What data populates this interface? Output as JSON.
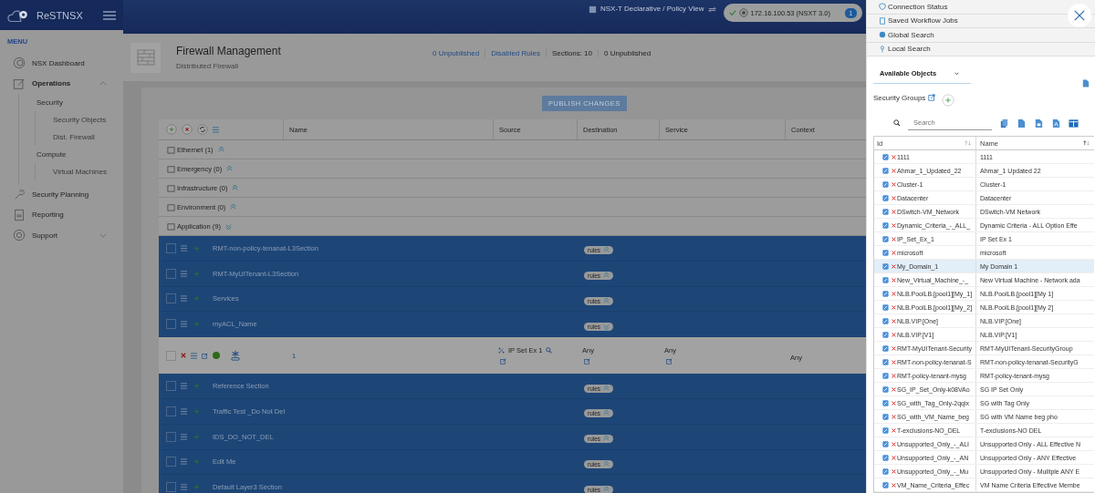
{
  "app": {
    "name": "ReSTNSX"
  },
  "topbar": {
    "view": "NSX-T Declarative / Policy View",
    "connection": "172.16.100.53 (NSXT 3.0)",
    "connected": true,
    "badge": "1"
  },
  "sidebar": {
    "heading": "MENU",
    "items": [
      {
        "label": "NSX Dashboard",
        "kind": "link"
      },
      {
        "label": "Operations",
        "kind": "group",
        "expanded": true,
        "children": [
          {
            "label": "Security",
            "children": [
              {
                "label": "Security Objects"
              },
              {
                "label": "Dist. Firewall"
              }
            ]
          },
          {
            "label": "Compute",
            "children": [
              {
                "label": "Virtual Machines"
              }
            ]
          }
        ]
      },
      {
        "label": "Security Planning",
        "kind": "link"
      },
      {
        "label": "Reporting",
        "kind": "link"
      },
      {
        "label": "Support",
        "kind": "group",
        "expanded": false
      }
    ]
  },
  "page": {
    "title": "Firewall Management",
    "subtitle": "Distributed Firewall",
    "stats": [
      {
        "text": "0 Unpublished",
        "kind": "link"
      },
      {
        "text": "Disabled Rules",
        "kind": "link"
      },
      {
        "text": "Sections: 10",
        "kind": "text"
      },
      {
        "text": "0 Unpublished",
        "kind": "text"
      }
    ],
    "publish": "PUBLISH CHANGES"
  },
  "table": {
    "columns": [
      "Name",
      "Source",
      "Destination",
      "Service",
      "Context"
    ],
    "categories": [
      {
        "label": "Ethernet (1)",
        "expanded": false
      },
      {
        "label": "Emergency (0)",
        "expanded": false
      },
      {
        "label": "Infrastructure (0)",
        "expanded": false
      },
      {
        "label": "Environment (0)",
        "expanded": false
      },
      {
        "label": "Application (9)",
        "expanded": true
      }
    ],
    "sections": [
      {
        "name": "RMT-non-policy-tenanat-L3Section",
        "rules_label": "rules",
        "checked": false,
        "expanded": false
      },
      {
        "name": "RMT-MyUITenant-L3Section",
        "rules_label": "rules",
        "checked": false,
        "expanded": false
      },
      {
        "name": "Services",
        "rules_label": "rules",
        "checked": false,
        "expanded": false
      },
      {
        "name": "myACL_Name",
        "rules_label": "rules",
        "checked": false,
        "expanded": true,
        "rules": [
          {
            "number": "1",
            "checked": false,
            "enabled": true,
            "source": "IP Set Ex 1",
            "destination": "Any",
            "service": "Any",
            "context": "Any"
          }
        ]
      },
      {
        "name": "Reference Section",
        "rules_label": "rules",
        "checked": false,
        "expanded": false
      },
      {
        "name": "Traffic Test _Do Not Del",
        "rules_label": "rules",
        "checked": false,
        "expanded": false
      },
      {
        "name": "IDS_DO_NOT_DEL",
        "rules_label": "rules",
        "checked": false,
        "expanded": false
      },
      {
        "name": "Edit Me",
        "rules_label": "rules",
        "checked": false,
        "expanded": false
      },
      {
        "name": "Default Layer3 Section",
        "rules_label": "rules",
        "checked": false,
        "expanded": false
      }
    ]
  },
  "drawer": {
    "accordions": [
      {
        "label": "Connection Status"
      },
      {
        "label": "Saved Workflow Jobs"
      },
      {
        "label": "Global Search"
      },
      {
        "label": "Local Search"
      }
    ],
    "dropdown": "Available Objects",
    "group_label": "Security Groups",
    "search": {
      "placeholder": "Search"
    },
    "columns": [
      "Id",
      "Name"
    ],
    "rows": [
      {
        "id": "1111",
        "name": "1111",
        "selected": false
      },
      {
        "id": "Ahmar_1_Updated_22",
        "name": "Ahmar_1 Updated 22",
        "selected": false
      },
      {
        "id": "Cluster-1",
        "name": "Cluster-1",
        "selected": false
      },
      {
        "id": "Datacenter",
        "name": "Datacenter",
        "selected": false
      },
      {
        "id": "DSwitch-VM_Network",
        "name": "DSwitch-VM Network",
        "selected": false
      },
      {
        "id": "Dynamic_Criteria_-_ALL_",
        "name": "Dynamic Criteria - ALL Option Effe",
        "selected": false
      },
      {
        "id": "IP_Set_Ex_1",
        "name": "IP Set Ex 1",
        "selected": false
      },
      {
        "id": "microsoft",
        "name": "microsoft",
        "selected": false
      },
      {
        "id": "My_Domain_1",
        "name": "My Domain 1",
        "selected": true
      },
      {
        "id": "New_Virtual_Machine_-_",
        "name": "New Virtual Machine - Network ada",
        "selected": false
      },
      {
        "id": "NLB.PoolLB.[pool1][My_1]",
        "name": "NLB.PoolLB.[pool1][My 1]",
        "selected": false
      },
      {
        "id": "NLB.PoolLB.[pool1][My_2]",
        "name": "NLB.PoolLB.[pool1][My 2]",
        "selected": false
      },
      {
        "id": "NLB.VIP.[One]",
        "name": "NLB.VIP.[One]",
        "selected": false
      },
      {
        "id": "NLB.VIP.[V1]",
        "name": "NLB.VIP.[V1]",
        "selected": false
      },
      {
        "id": "RMT-MyUITenant-Security",
        "name": "RMT-MyUITenant-SecurityGroup",
        "selected": false
      },
      {
        "id": "RMT-non-policy-tenanat-S",
        "name": "RMT-non-policy-tenanat-SecurityG",
        "selected": false
      },
      {
        "id": "RMT-policy-tenant-mysg",
        "name": "RMT-policy-tenant-mysg",
        "selected": false
      },
      {
        "id": "SG_IP_Set_Only-k08VAo",
        "name": "SG IP Set Only",
        "selected": false
      },
      {
        "id": "SG_with_Tag_Only-2qqix",
        "name": "SG with Tag Only",
        "selected": false
      },
      {
        "id": "SG_with_VM_Name_beg",
        "name": "SG with VM Name beg pho",
        "selected": false
      },
      {
        "id": "T-exclusions-NO_DEL",
        "name": "T-exclusions-NO DEL",
        "selected": false
      },
      {
        "id": "Unsupported_Only_-_ALI",
        "name": "Unsupported Only - ALL Effective N",
        "selected": false
      },
      {
        "id": "Unsupported_Only_-_AN",
        "name": "Unsupported Only - ANY Effective",
        "selected": false
      },
      {
        "id": "Unsupported_Only_-_Mu",
        "name": "Unsupported Only - Mulitple ANY E",
        "selected": false
      },
      {
        "id": "VM_Name_Criteria_Effec",
        "name": "VM Name Criteria Effective Membe",
        "selected": false
      }
    ]
  }
}
